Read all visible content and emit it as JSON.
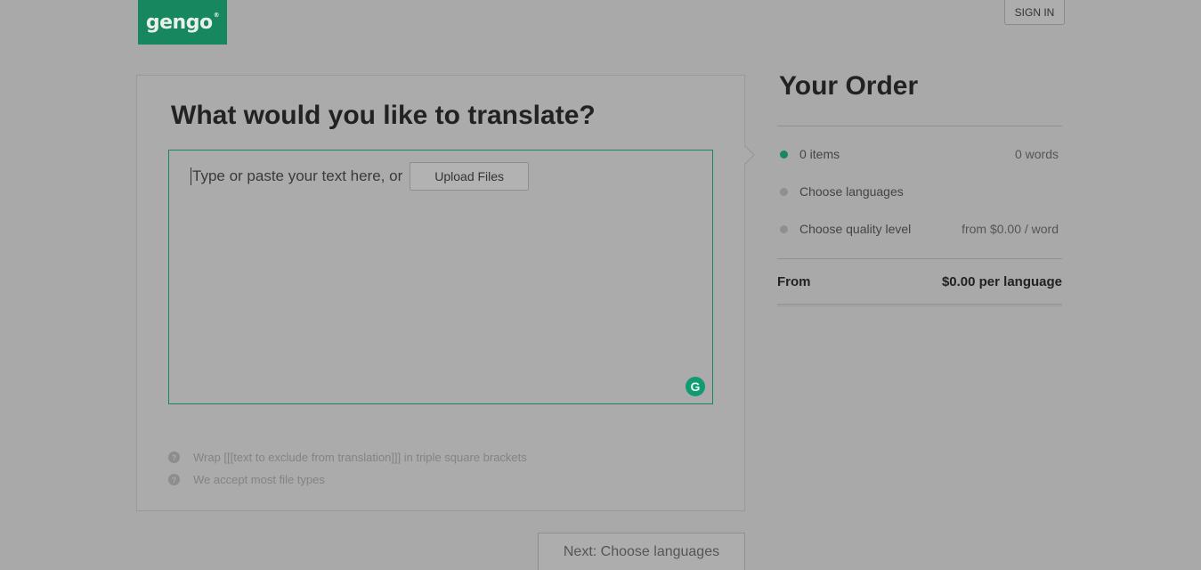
{
  "header": {
    "logo_text": "gengo",
    "logo_mark": "®",
    "sign_in_label": "SIGN IN",
    "brand_color": "#17875f"
  },
  "editor": {
    "title": "What would you like to translate?",
    "placeholder": "Type or paste your text here, or",
    "upload_label": "Upload Files",
    "grammarly_glyph": "G"
  },
  "hints": [
    {
      "icon": "help-icon",
      "text": "Wrap [[[text to exclude from translation]]] in triple square brackets"
    },
    {
      "icon": "help-icon",
      "text": "We accept most file types"
    }
  ],
  "next_button_label": "Next: Choose languages",
  "order": {
    "title": "Your Order",
    "steps": [
      {
        "label": "0 items",
        "value": "0 words",
        "active": true
      },
      {
        "label": "Choose languages",
        "value": "",
        "active": false
      },
      {
        "label": "Choose quality level",
        "value": "from $0.00 / word",
        "active": false
      }
    ],
    "total_label": "From",
    "total_value": "$0.00 per language"
  }
}
